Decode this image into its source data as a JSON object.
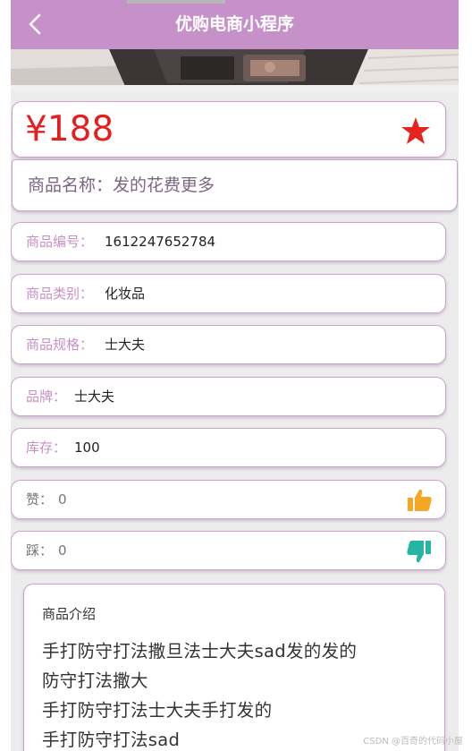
{
  "header": {
    "title": "优购电商小程序"
  },
  "product": {
    "price": "¥188",
    "name": "商品名称：发的花费更多",
    "fields": [
      {
        "label": "商品编号：",
        "value": "1612247652784"
      },
      {
        "label": "商品类别：",
        "value": "化妆品"
      },
      {
        "label": "商品规格：",
        "value": "士大夫"
      },
      {
        "label": "品牌：",
        "value": "士大夫"
      },
      {
        "label": "库存：",
        "value": "100"
      }
    ],
    "like": {
      "label": "赞：",
      "value": "0",
      "icon": "thumbs-up-icon",
      "color": "#f5a623"
    },
    "dislike": {
      "label": "踩：",
      "value": "0",
      "icon": "thumbs-down-icon",
      "color": "#26b5a2"
    }
  },
  "intro": {
    "title": "商品介绍",
    "lines": [
      "手打防守打法撒旦法士大夫sad发的发的",
      "防守打法撒大",
      "手打防守打法士大夫手打发的",
      "手打防守打法sad"
    ]
  },
  "watermark": "CSDN @百奇的代码小屋",
  "colors": {
    "header": "#c591c8",
    "price": "#e41f1f",
    "label": "#c98fc6",
    "star": "#e8231f"
  }
}
